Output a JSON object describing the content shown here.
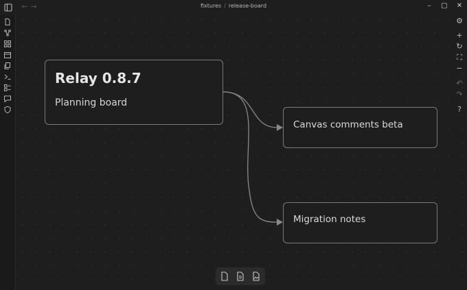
{
  "titlebar": {
    "breadcrumb_folder": "fixtures",
    "breadcrumb_separator": "/",
    "breadcrumb_file": "release-board"
  },
  "cards": {
    "main_title": "Relay 0.8.7",
    "main_subtitle": "Planning board",
    "card_comments": "Canvas comments beta",
    "card_migration": "Migration notes"
  },
  "colors": {
    "background": "#1e1e1e",
    "card_border": "#7a7a7a",
    "edge": "#8a8a8a",
    "text": "#dadada"
  },
  "icons": {
    "ribbon": [
      "file-icon",
      "graph-icon",
      "grid-icon",
      "calendar-icon",
      "copy-icon",
      "terminal-icon",
      "layout-icon",
      "chat-icon",
      "shield-icon"
    ],
    "controls": [
      "settings-icon",
      "zoom-in-icon",
      "reset-zoom-icon",
      "fit-icon",
      "zoom-out-icon",
      "undo-icon",
      "redo-icon",
      "help-icon"
    ],
    "toolbar": [
      "new-card-icon",
      "note-icon",
      "media-icon"
    ]
  }
}
